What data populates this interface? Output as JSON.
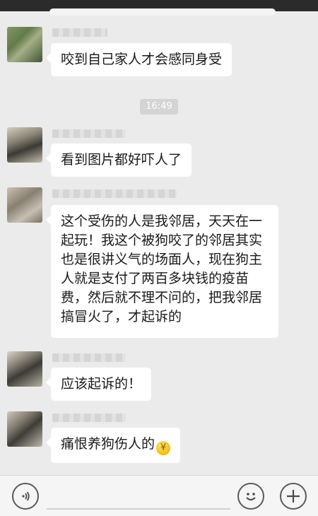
{
  "timestamp": "16:49",
  "messages": [
    {
      "text": "咬到自己家人才会感同身受"
    },
    {
      "text": "看到图片都好吓人了"
    },
    {
      "lines": [
        "这个受伤的人是我邻居，天天在一",
        "起玩！我这个被狗咬了的邻居其实",
        "也是很讲义气的场面人，现在狗主",
        "人就是支付了两百多块钱的疫苗",
        "费，然后就不理不问的，把我邻居",
        "搞冒火了，才起诉的"
      ]
    },
    {
      "text": "应该起诉的！"
    },
    {
      "text": "痛恨养狗伤人的",
      "emoji": "coin-emoji"
    }
  ],
  "input": {
    "voice_icon": "voice-icon",
    "emoji_icon": "smiley-icon",
    "more_icon": "plus-icon"
  }
}
